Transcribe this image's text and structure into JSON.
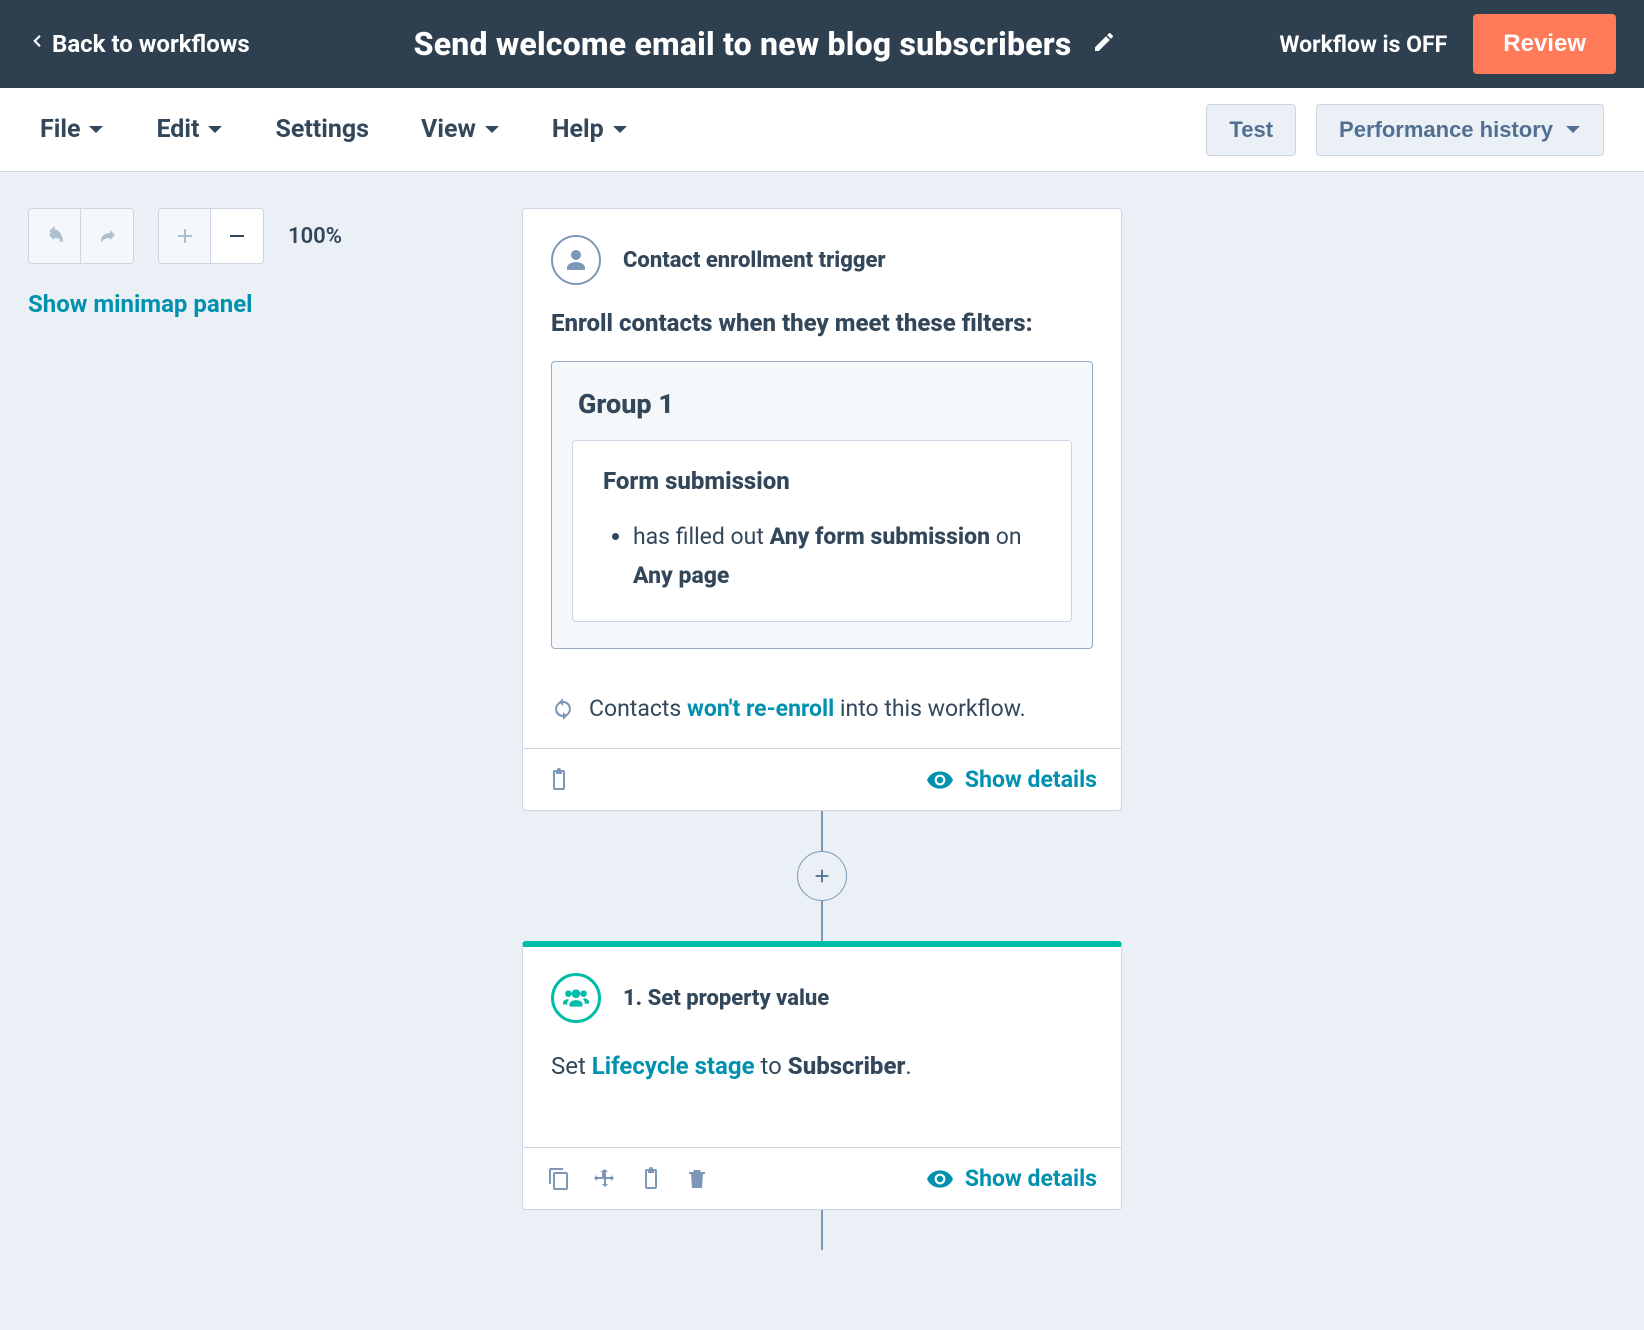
{
  "header": {
    "back": "Back to workflows",
    "title": "Send welcome email to new blog subscribers",
    "status": "Workflow is OFF",
    "review": "Review"
  },
  "menubar": {
    "file": "File",
    "edit": "Edit",
    "settings": "Settings",
    "view": "View",
    "help": "Help",
    "test": "Test",
    "performance": "Performance history"
  },
  "tools": {
    "zoom": "100%",
    "minimapLink": "Show minimap panel"
  },
  "trigger": {
    "title": "Contact enrollment trigger",
    "enrollLine": "Enroll contacts when they meet these filters:",
    "groupTitle": "Group 1",
    "filterTitle": "Form submission",
    "filterLine_pre": "has filled out ",
    "filterLine_b1": "Any form submission",
    "filterLine_mid": " on ",
    "filterLine_b2": "Any page",
    "reenroll_pre": "Contacts ",
    "reenroll_link": "won't re-enroll",
    "reenroll_post": " into this workflow.",
    "showDetails": "Show details"
  },
  "action1": {
    "title": "1. Set property value",
    "desc_pre": "Set ",
    "desc_link": "Lifecycle stage",
    "desc_mid": " to ",
    "desc_b": "Subscriber",
    "desc_post": ".",
    "showDetails": "Show details"
  }
}
